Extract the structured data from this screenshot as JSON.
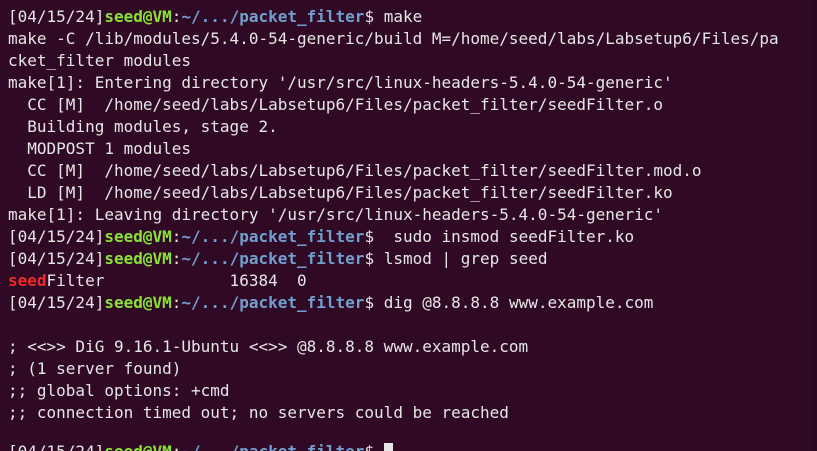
{
  "prompt": {
    "date": "[04/15/24]",
    "user": "seed@VM",
    "colon": ":",
    "path": "~/.../packet_filter",
    "sym": "$"
  },
  "commands": {
    "make": " make",
    "insmod": "  sudo insmod seedFilter.ko",
    "lsmod": " lsmod | grep seed",
    "dig": " dig @8.8.8.8 www.example.com"
  },
  "output": {
    "make_line1": "make -C /lib/modules/5.4.0-54-generic/build M=/home/seed/labs/Labsetup6/Files/pa",
    "make_line2": "cket_filter modules",
    "make_line3": "make[1]: Entering directory '/usr/src/linux-headers-5.4.0-54-generic'",
    "make_line4": "  CC [M]  /home/seed/labs/Labsetup6/Files/packet_filter/seedFilter.o",
    "make_line5": "  Building modules, stage 2.",
    "make_line6": "  MODPOST 1 modules",
    "make_line7": "  CC [M]  /home/seed/labs/Labsetup6/Files/packet_filter/seedFilter.mod.o",
    "make_line8": "  LD [M]  /home/seed/labs/Labsetup6/Files/packet_filter/seedFilter.ko",
    "make_line9": "make[1]: Leaving directory '/usr/src/linux-headers-5.4.0-54-generic'",
    "lsmod_match": "seed",
    "lsmod_rest": "Filter             16384  0",
    "dig_line1": "; <<>> DiG 9.16.1-Ubuntu <<>> @8.8.8.8 www.example.com",
    "dig_line2": "; (1 server found)",
    "dig_line3": ";; global options: +cmd",
    "dig_line4": ";; connection timed out; no servers could be reached"
  }
}
